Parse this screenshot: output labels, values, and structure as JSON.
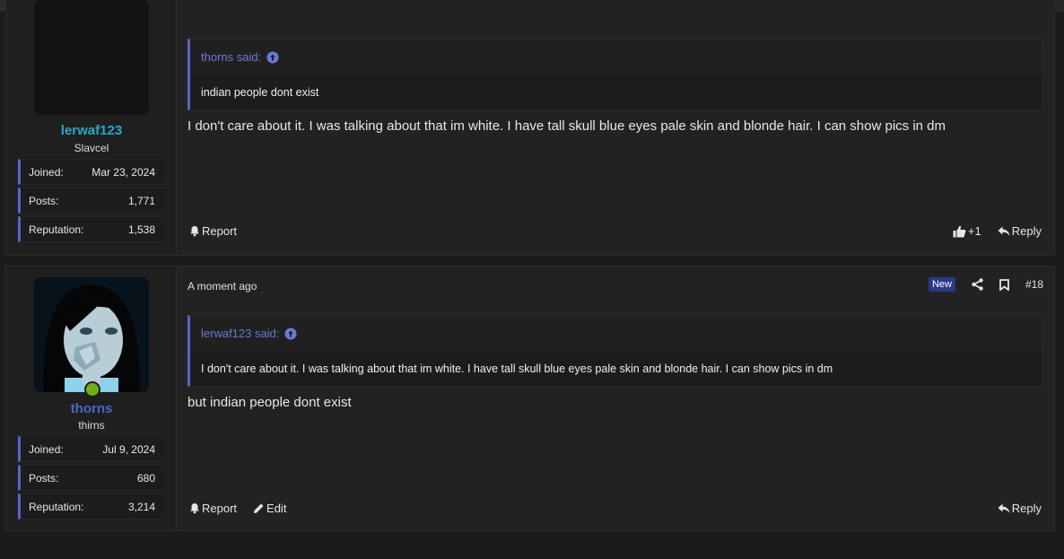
{
  "posts": [
    {
      "username": "lerwaf123",
      "user_title": "Slavcel",
      "stats": [
        {
          "label": "Joined:",
          "value": "Mar 23, 2024"
        },
        {
          "label": "Posts:",
          "value": "1,771"
        },
        {
          "label": "Reputation:",
          "value": "1,538"
        }
      ],
      "quote_author": "thorns said:",
      "quote_text": "indian people dont exist",
      "message": "I don't care about it. I was talking about that im white. I have tall skull blue eyes pale skin and blonde hair. I can show pics in dm",
      "report_label": "Report",
      "reaction_count": "+1",
      "reply_label": "Reply"
    },
    {
      "username": "thorns",
      "user_title": "thirns",
      "stats": [
        {
          "label": "Joined:",
          "value": "Jul 9, 2024"
        },
        {
          "label": "Posts:",
          "value": "680"
        },
        {
          "label": "Reputation:",
          "value": "3,214"
        }
      ],
      "time": "A moment ago",
      "badge": "New",
      "post_number": "#18",
      "quote_author": "lerwaf123 said:",
      "quote_text": "I don't care about it. I was talking about that im white. I have tall skull blue eyes pale skin and blonde hair. I can show pics in dm",
      "message": "but indian people dont exist",
      "report_label": "Report",
      "edit_label": "Edit",
      "reply_label": "Reply"
    }
  ],
  "colors": {
    "accent": "#5865c7",
    "username1": "#2aa8c7",
    "username2": "#4a67c9",
    "online": "#6fb01a"
  }
}
